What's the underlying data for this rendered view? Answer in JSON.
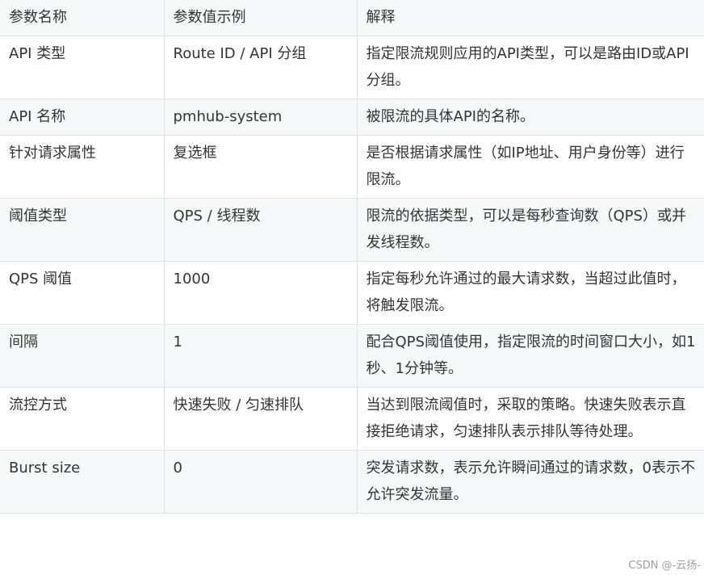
{
  "table": {
    "headers": [
      "参数名称",
      "参数值示例",
      "解释"
    ],
    "rows": [
      [
        "API 类型",
        "Route ID / API 分组",
        "指定限流规则应用的API类型，可以是路由ID或API分组。"
      ],
      [
        "API 名称",
        "pmhub-system",
        "被限流的具体API的名称。"
      ],
      [
        "针对请求属性",
        "复选框",
        "是否根据请求属性（如IP地址、用户身份等）进行限流。"
      ],
      [
        "阈值类型",
        "QPS / 线程数",
        "限流的依据类型，可以是每秒查询数（QPS）或并发线程数。"
      ],
      [
        "QPS 阈值",
        "1000",
        "指定每秒允许通过的最大请求数，当超过此值时，将触发限流。"
      ],
      [
        "间隔",
        "1",
        "配合QPS阈值使用，指定限流的时间窗口大小，如1秒、1分钟等。"
      ],
      [
        "流控方式",
        "快速失败 / 匀速排队",
        "当达到限流阈值时，采取的策略。快速失败表示直接拒绝请求，匀速排队表示排队等待处理。"
      ],
      [
        "Burst size",
        "0",
        "突发请求数，表示允许瞬间通过的请求数，0表示不允许突发流量。"
      ]
    ]
  },
  "watermark": "CSDN @-云扬-"
}
